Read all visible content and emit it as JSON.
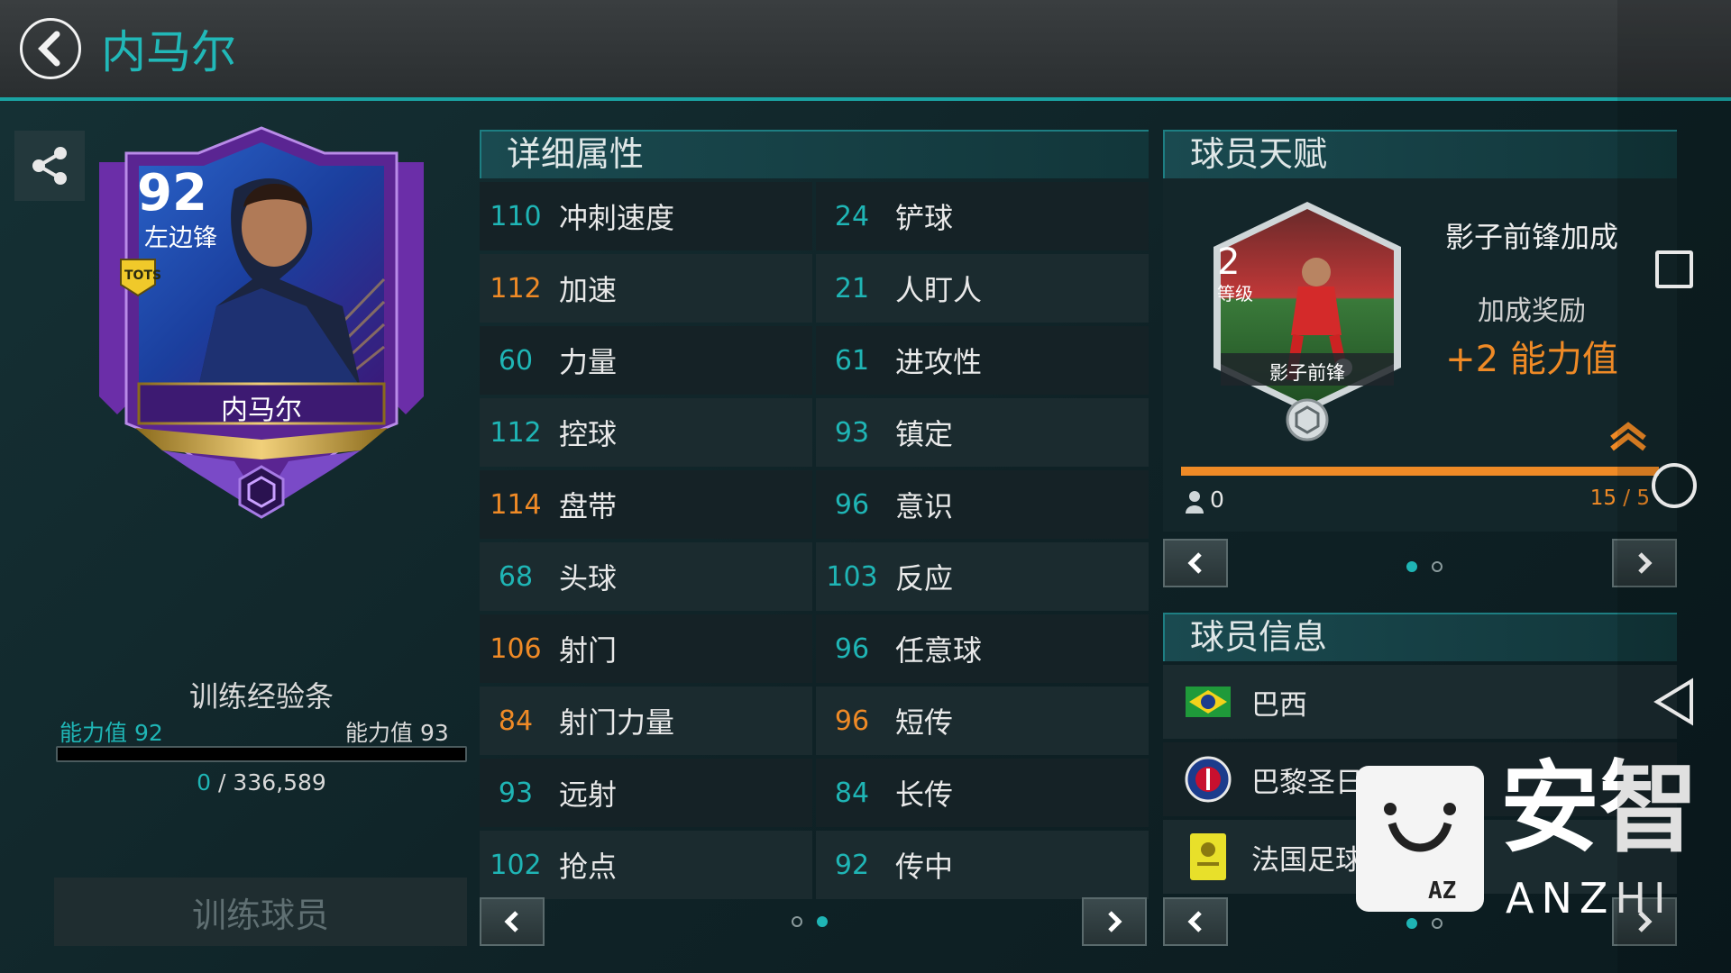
{
  "header": {
    "title": "内马尔"
  },
  "card": {
    "rating": "92",
    "position": "左边锋",
    "badge": "TOTS",
    "name": "内马尔"
  },
  "training": {
    "title": "训练经验条",
    "left_label": "能力值 92",
    "right_label": "能力值 93",
    "progress": 0,
    "current": "0",
    "separator": "/",
    "total": "336,589",
    "button": "训练球员"
  },
  "attributes": {
    "title": "详细属性",
    "rows": [
      {
        "left": {
          "value": "110",
          "name": "冲刺速度",
          "color": "teal"
        },
        "right": {
          "value": "24",
          "name": "铲球",
          "color": "teal"
        }
      },
      {
        "left": {
          "value": "112",
          "name": "加速",
          "color": "orange"
        },
        "right": {
          "value": "21",
          "name": "人盯人",
          "color": "teal"
        }
      },
      {
        "left": {
          "value": "60",
          "name": "力量",
          "color": "teal"
        },
        "right": {
          "value": "61",
          "name": "进攻性",
          "color": "teal"
        }
      },
      {
        "left": {
          "value": "112",
          "name": "控球",
          "color": "teal"
        },
        "right": {
          "value": "93",
          "name": "镇定",
          "color": "teal"
        }
      },
      {
        "left": {
          "value": "114",
          "name": "盘带",
          "color": "orange"
        },
        "right": {
          "value": "96",
          "name": "意识",
          "color": "teal"
        }
      },
      {
        "left": {
          "value": "68",
          "name": "头球",
          "color": "teal"
        },
        "right": {
          "value": "103",
          "name": "反应",
          "color": "teal"
        }
      },
      {
        "left": {
          "value": "106",
          "name": "射门",
          "color": "orange"
        },
        "right": {
          "value": "96",
          "name": "任意球",
          "color": "teal"
        }
      },
      {
        "left": {
          "value": "84",
          "name": "射门力量",
          "color": "orange"
        },
        "right": {
          "value": "96",
          "name": "短传",
          "color": "orange"
        }
      },
      {
        "left": {
          "value": "93",
          "name": "远射",
          "color": "teal"
        },
        "right": {
          "value": "84",
          "name": "长传",
          "color": "teal"
        }
      },
      {
        "left": {
          "value": "102",
          "name": "抢点",
          "color": "teal"
        },
        "right": {
          "value": "92",
          "name": "传中",
          "color": "teal"
        }
      }
    ],
    "page": 2,
    "pages": 2
  },
  "talent": {
    "title": "球员天赋",
    "level": "2",
    "level_label": "等级",
    "badge_name": "影子前锋",
    "skill_name": "影子前锋加成",
    "bonus_label": "加成奖励",
    "bonus_value": "+2 能力值",
    "points": "0",
    "progress_text": "15 / 5",
    "progress": 1.0,
    "page": 1,
    "pages": 2
  },
  "info": {
    "title": "球员信息",
    "items": [
      {
        "name": "巴西",
        "icon": "brazil-flag-icon"
      },
      {
        "name": "巴黎圣日耳曼",
        "icon": "psg-crest-icon"
      },
      {
        "name": "法国足球甲级联赛",
        "icon": "ligue1-logo-icon"
      }
    ],
    "page": 1,
    "pages": 2
  },
  "watermark": {
    "cn": "安智",
    "en": "ANZHI",
    "tag": "AZ"
  },
  "system_nav": [
    "square-icon",
    "circle-icon",
    "triangle-icon"
  ],
  "colors": {
    "accent": "#1fb5b5",
    "highlight": "#ef8a26",
    "card_purple": "#6a2fb0"
  }
}
